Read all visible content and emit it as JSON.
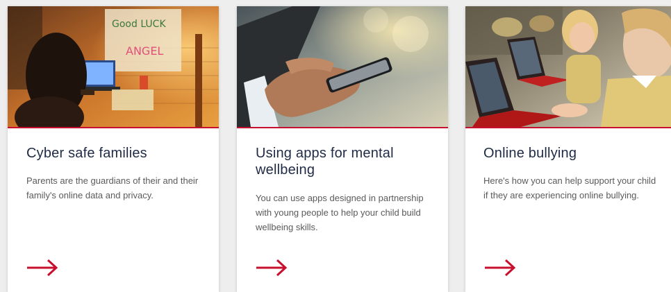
{
  "theme": {
    "accent": "#c8102e",
    "title_color": "#1f2a44",
    "text_color": "#5a5a5a"
  },
  "cards": [
    {
      "title": "Cyber safe families",
      "description": "Parents are the guardians of their and their family's online data and privacy.",
      "image_icon": "girl-at-laptop-photo",
      "arrow_icon": "arrow-right-icon"
    },
    {
      "title": "Using apps for mental wellbeing",
      "description": "You can use apps designed in partnership with young people to help your child build wellbeing skills.",
      "image_icon": "hand-holding-phone-photo",
      "arrow_icon": "arrow-right-icon"
    },
    {
      "title": "Online bullying",
      "description": "Here's how you can help support your child if they are experiencing online bullying.",
      "image_icon": "students-with-laptops-photo",
      "arrow_icon": "arrow-right-icon"
    }
  ]
}
